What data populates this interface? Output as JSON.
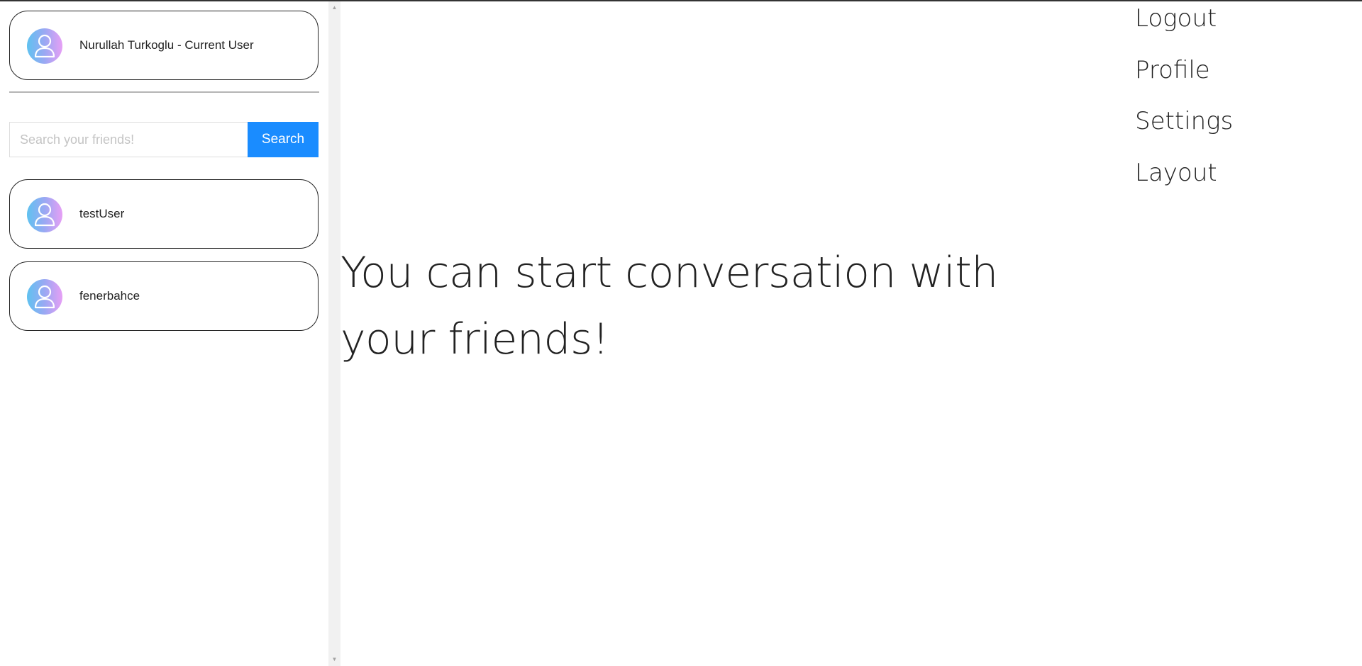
{
  "sidebar": {
    "current_user": {
      "label": "Nurullah Turkoglu - Current User",
      "icon": "user-icon"
    },
    "search": {
      "placeholder": "Search your friends!",
      "value": "",
      "button_label": "Search"
    },
    "friends": [
      {
        "name": "testUser",
        "icon": "user-icon"
      },
      {
        "name": "fenerbahce",
        "icon": "user-icon"
      }
    ]
  },
  "main": {
    "message": "You can start conversation with your friends!"
  },
  "menu": {
    "items": [
      {
        "label": "Logout"
      },
      {
        "label": "Profile"
      },
      {
        "label": "Settings"
      },
      {
        "label": "Layout"
      }
    ]
  },
  "colors": {
    "accent": "#1a8cff",
    "avatar_gradient_start": "#5fc2f0",
    "avatar_gradient_end": "#e79ff5"
  }
}
